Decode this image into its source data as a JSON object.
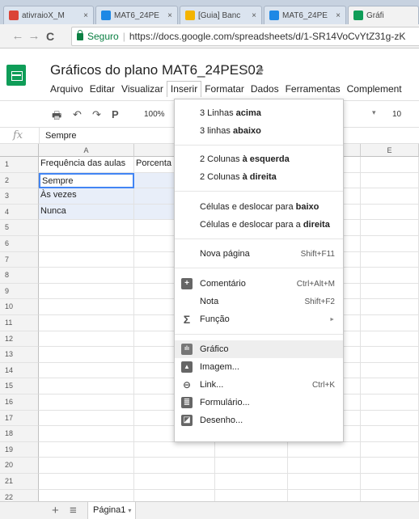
{
  "browser": {
    "tabs": [
      {
        "title": "ativraioX_M",
        "favicon_color": "#db4437"
      },
      {
        "title": "MAT6_24PE",
        "favicon_color": "#1e88e5"
      },
      {
        "title": "[Guia] Banc",
        "favicon_color": "#f4b400"
      },
      {
        "title": "MAT6_24PE",
        "favicon_color": "#1e88e5"
      },
      {
        "title": "Gráfi",
        "favicon_color": "#0f9d58"
      }
    ],
    "close_glyph": "×",
    "nav": {
      "back": "←",
      "forward": "→",
      "reload": "C"
    },
    "secure_label": "Seguro",
    "url": "https://docs.google.com/spreadsheets/d/1-SR14VoCvYtZ31g-zK"
  },
  "doc": {
    "title": "Gráficos do plano MAT6_24PES02",
    "star_icon": "☆",
    "share_icon": "♣"
  },
  "menus": [
    "Arquivo",
    "Editar",
    "Visualizar",
    "Inserir",
    "Formatar",
    "Dados",
    "Ferramentas",
    "Complement"
  ],
  "toolbar": {
    "print_icon": "🖶",
    "undo_icon": "↶",
    "redo_icon": "↷",
    "paint_icon": "P",
    "zoom": "100%",
    "dropdown_caret": "▾",
    "font_size": "10"
  },
  "formula_bar": {
    "fx_label": "fx",
    "value": "Sempre"
  },
  "grid": {
    "columns": [
      "A",
      "",
      "",
      "",
      "E"
    ],
    "rows": [
      "1",
      "2",
      "3",
      "4",
      "5",
      "6",
      "7",
      "8",
      "9",
      "10",
      "11",
      "12",
      "13",
      "14",
      "15",
      "16",
      "17",
      "18",
      "19",
      "20",
      "21",
      "22"
    ],
    "cells": {
      "a1": "Frequência das aulas",
      "b1": "Porcenta",
      "a2": "Sempre",
      "a3": "Às vezes",
      "a4": "Nunca"
    }
  },
  "insert_menu": {
    "rows_above_pre": "3 Linhas ",
    "rows_above_bold": "acima",
    "rows_below_pre": "3 linhas ",
    "rows_below_bold": "abaixo",
    "cols_left_pre": "2 Colunas ",
    "cols_left_bold": "à esquerda",
    "cols_right_pre": "2 Colunas ",
    "cols_right_bold": "à direita",
    "cells_down_pre": "Células e deslocar para ",
    "cells_down_bold": "baixo",
    "cells_right_pre": "Células e deslocar para a ",
    "cells_right_bold": "direita",
    "new_page": "Nova página",
    "new_page_shortcut": "Shift+F11",
    "comment": "Comentário",
    "comment_shortcut": "Ctrl+Alt+M",
    "note": "Nota",
    "note_shortcut": "Shift+F2",
    "function": "Função",
    "function_arrow": "►",
    "chart": "Gráfico",
    "image": "Imagem...",
    "link": "Link...",
    "link_shortcut": "Ctrl+K",
    "form": "Formulário...",
    "drawing": "Desenho...",
    "icons": {
      "comment": "+",
      "function": "Σ",
      "chart": "ılı",
      "image": "▲",
      "link": "⊖",
      "form": "≣",
      "drawing": "◪"
    }
  },
  "sheet_tabs": {
    "add_icon": "+",
    "list_icon": "≡",
    "active": "Página1",
    "caret": "▾"
  }
}
